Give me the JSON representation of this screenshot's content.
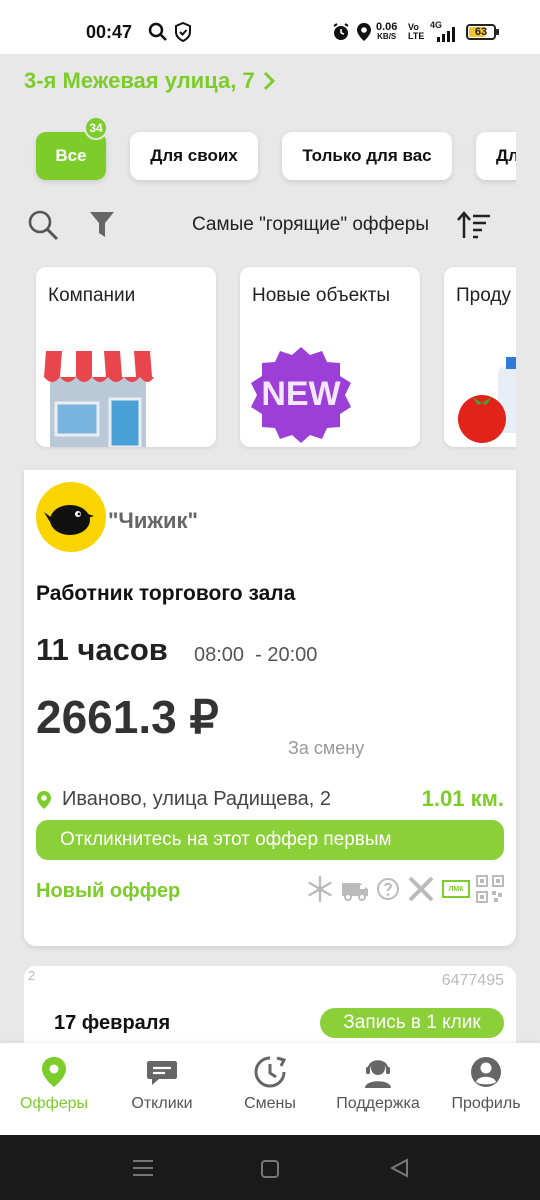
{
  "status_bar": {
    "time": "00:47",
    "net_speed_value": "0.06",
    "net_speed_unit": "KB/S",
    "network": "4G",
    "lte_top": "Vo",
    "lte_bottom": "LTE",
    "battery": "63",
    "icons": [
      "search-icon",
      "shield-icon",
      "alarm-icon",
      "location-icon",
      "signal-icon",
      "battery-icon"
    ]
  },
  "header": {
    "address": "3-я Межевая улица, 7"
  },
  "filters": {
    "badge_count": "34",
    "chips": [
      {
        "label": "Все",
        "active": true
      },
      {
        "label": "Для своих",
        "active": false
      },
      {
        "label": "Только для вас",
        "active": false
      },
      {
        "label": "Дл",
        "active": false
      }
    ]
  },
  "tools": {
    "sort_label": "Самые \"горящие\" офферы"
  },
  "categories": [
    {
      "title": "Компании",
      "icon": "shop-icon"
    },
    {
      "title": "Новые объекты",
      "icon": "new-badge-icon",
      "badge_text": "NEW"
    },
    {
      "title": "Проду",
      "icon": "products-icon"
    }
  ],
  "offer": {
    "company": "\"Чижик\"",
    "title": "Работник торгового зала",
    "hours": "11 часов",
    "time_range": "08:00  - 20:00",
    "price": "2661.3 ₽",
    "per_shift": "За смену",
    "location": "Иваново, улица Радищева, 2",
    "distance": "1.01 км.",
    "respond_text": "Откликнитесь на этот оффер первым",
    "new_offer_label": "Новый оффер",
    "feature_icons": [
      "snowflake-icon",
      "van-icon",
      "question-icon",
      "tools-icon",
      "lmk-icon",
      "qr-icon"
    ],
    "lmk_text": "ЛМК"
  },
  "offer2": {
    "index": "2",
    "id": "6477495",
    "date": "17 февраля",
    "button": "Запись в 1 клик"
  },
  "bottom_nav": [
    {
      "label": "Офферы",
      "icon": "location-pin-icon",
      "active": true
    },
    {
      "label": "Отклики",
      "icon": "chat-icon",
      "active": false
    },
    {
      "label": "Смены",
      "icon": "clock-icon",
      "active": false
    },
    {
      "label": "Поддержка",
      "icon": "support-icon",
      "active": false
    },
    {
      "label": "Профиль",
      "icon": "profile-icon",
      "active": false
    }
  ],
  "colors": {
    "accent": "#7ccc2a",
    "background": "#e8e8e8",
    "logo_yellow": "#f9d400"
  }
}
